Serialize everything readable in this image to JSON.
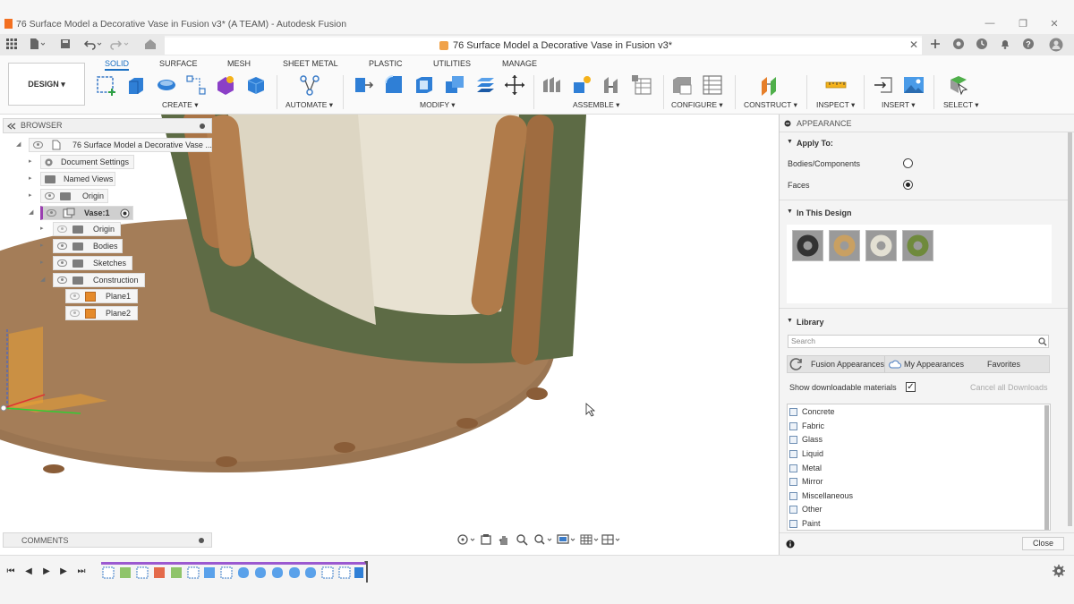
{
  "window": {
    "title": "76 Surface Model a Decorative Vase in Fusion v3* (A TEAM) - Autodesk Fusion",
    "min_icon": "—",
    "max_icon": "❐",
    "close_icon": "✕"
  },
  "document_tab": {
    "title": "76 Surface Model a Decorative Vase in Fusion v3*",
    "close_icon": "✕"
  },
  "workspace": {
    "label": "DESIGN ▾"
  },
  "ribbon": {
    "tabs": [
      "SOLID",
      "SURFACE",
      "MESH",
      "SHEET METAL",
      "PLASTIC",
      "UTILITIES",
      "MANAGE"
    ],
    "active_tab": "SOLID",
    "groups": [
      "CREATE ▾",
      "AUTOMATE ▾",
      "MODIFY ▾",
      "ASSEMBLE ▾",
      "CONFIGURE ▾",
      "CONSTRUCT ▾",
      "INSPECT ▾",
      "INSERT ▾",
      "SELECT ▾"
    ]
  },
  "browser": {
    "title": "BROWSER",
    "items": [
      {
        "label": "76 Surface Model a Decorative Vase ..."
      },
      {
        "label": "Document Settings"
      },
      {
        "label": "Named Views"
      },
      {
        "label": "Origin"
      },
      {
        "label": "Vase:1"
      },
      {
        "label": "Origin"
      },
      {
        "label": "Bodies"
      },
      {
        "label": "Sketches"
      },
      {
        "label": "Construction"
      },
      {
        "label": "Plane1"
      },
      {
        "label": "Plane2"
      }
    ]
  },
  "comments": {
    "title": "COMMENTS"
  },
  "appearance": {
    "title": "APPEARANCE",
    "apply_to": {
      "heading": "Apply To:",
      "options": [
        {
          "label": "Bodies/Components",
          "selected": false
        },
        {
          "label": "Faces",
          "selected": true
        }
      ]
    },
    "in_this_design": {
      "heading": "In This Design",
      "swatch_colors": [
        "#3a3a3a",
        "#c9a062",
        "#d9d6c8",
        "#6f8a3c"
      ]
    },
    "library": {
      "heading": "Library",
      "search_placeholder": "Search",
      "tabs": [
        "Fusion Appearances",
        "My Appearances",
        "Favorites"
      ],
      "show_downloadable_label": "Show downloadable materials",
      "show_downloadable_checked": true,
      "cancel_downloads_label": "Cancel all Downloads",
      "materials": [
        "Concrete",
        "Fabric",
        "Glass",
        "Liquid",
        "Metal",
        "Mirror",
        "Miscellaneous",
        "Other",
        "Paint"
      ]
    },
    "close_label": "Close"
  },
  "colors": {
    "accent": "#1a6fc2",
    "vase_wall_inner": "#e8e2d2",
    "vase_wall_outer": "#5d6b45",
    "wood": "#a97446",
    "base": "#9a7552"
  }
}
